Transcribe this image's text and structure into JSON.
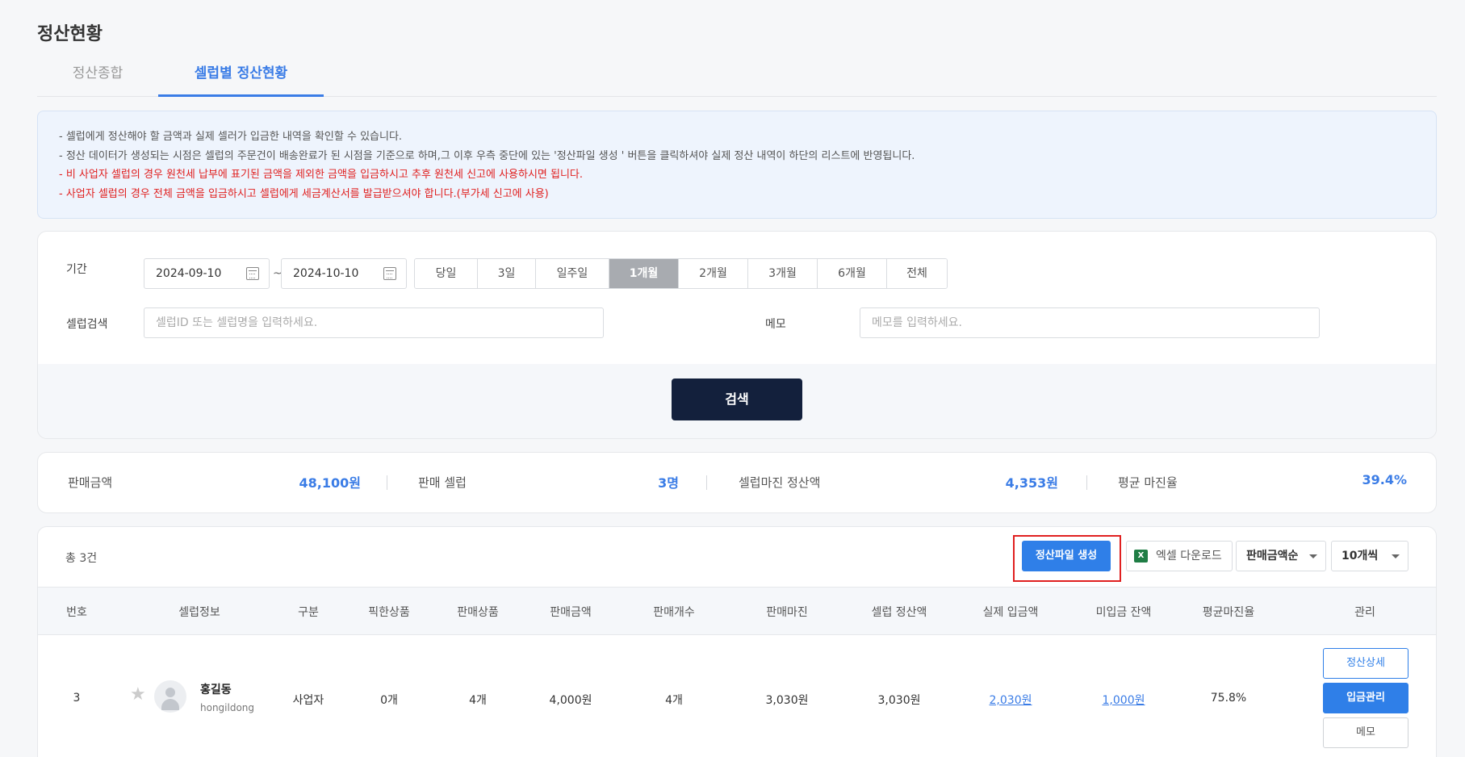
{
  "page": {
    "title": "정산현황"
  },
  "tabs": [
    {
      "label": "정산종합"
    },
    {
      "label": "셀럽별 정산현황"
    }
  ],
  "notice": [
    {
      "text": "- 셀럽에게 정산해야 할 금액과 실제 셀러가 입금한 내역을 확인할 수 있습니다."
    },
    {
      "text": "- 정산 데이터가 생성되는 시점은 셀럽의 주문건이 배송완료가 된 시점을 기준으로 하며,그 이후 우측 중단에 있는 '정산파일 생성 ' 버튼을 클릭하셔야 실제 정산 내역이 하단의 리스트에 반영됩니다."
    },
    {
      "text": "- 비 사업자 셀럽의 경우 원천세 납부에 표기된 금액을 제외한 금액을 입금하시고 추후 원천세 신고에 사용하시면 됩니다."
    },
    {
      "text": "- 사업자 셀럽의 경우 전체 금액을 입금하시고 셀럽에게 세금계산서를 발급받으셔야 합니다.(부가세 신고에 사용)"
    }
  ],
  "search": {
    "period_label": "기간",
    "start_date": "2024-09-10",
    "tilde": "~",
    "end_date": "2024-10-10",
    "periods": [
      "당일",
      "3일",
      "일주일",
      "1개월",
      "2개월",
      "3개월",
      "6개월",
      "전체"
    ],
    "active_period": "1개월",
    "celeb_label": "셀럽검색",
    "celeb_placeholder": "셀럽ID 또는 셀럽명을 입력하세요.",
    "memo_label": "메모",
    "memo_placeholder": "메모를 입력하세요.",
    "search_button": "검색"
  },
  "stats": {
    "sales_label": "판매금액",
    "sales_value": "48,100원",
    "celeb_label": "판매 셀럽",
    "celeb_value": "3명",
    "margin_label": "셀럽마진 정산액",
    "margin_value": "4,353원",
    "rate_label": "평균 마진율",
    "rate_value": "39.4%"
  },
  "list": {
    "total": "총 3건",
    "generate_button": "정산파일 생성",
    "excel_button": "엑셀 다운로드",
    "excel_icon": "X",
    "sort_select": "판매금액순",
    "size_select": "10개씩",
    "highlight_color": "#e02020",
    "columns": [
      "번호",
      "셀럽정보",
      "구분",
      "픽한상품",
      "판매상품",
      "판매금액",
      "판매개수",
      "판매마진",
      "셀럽 정산액",
      "실제 입금액",
      "미입금 잔액",
      "평균마진율",
      "관리"
    ],
    "rows": [
      {
        "no": "3",
        "name": "홍길동",
        "id": "hongildong",
        "type": "사업자",
        "picked": "0개",
        "products": "4개",
        "sales": "4,000원",
        "count": "4개",
        "margin": "3,030원",
        "settle": "3,030원",
        "paid": "2,030원",
        "unpaid": "1,000원",
        "rate": "75.8%",
        "actions": [
          "정산상세",
          "입금관리",
          "메모"
        ]
      }
    ]
  }
}
